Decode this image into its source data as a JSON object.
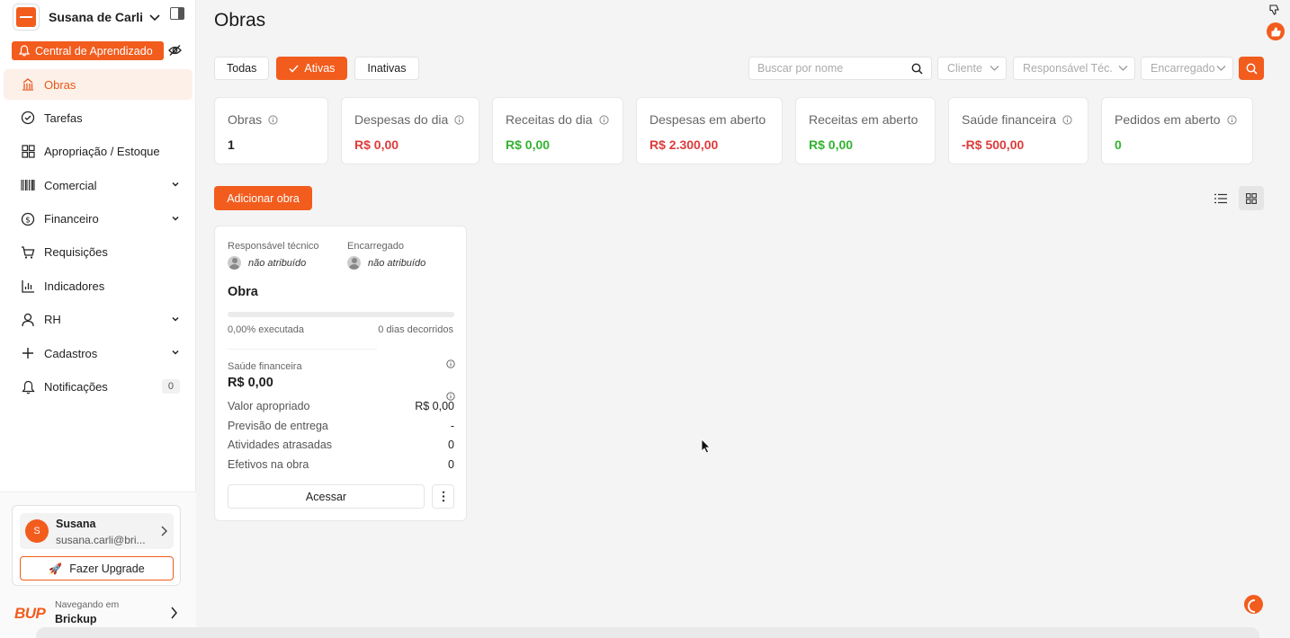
{
  "org": {
    "name": "Susana de Carli"
  },
  "learning": {
    "label": "Central de Aprendizado"
  },
  "nav": {
    "items": [
      {
        "label": "Obras"
      },
      {
        "label": "Tarefas"
      },
      {
        "label": "Apropriação / Estoque"
      },
      {
        "label": "Comercial"
      },
      {
        "label": "Financeiro"
      },
      {
        "label": "Requisições"
      },
      {
        "label": "Indicadores"
      },
      {
        "label": "RH"
      },
      {
        "label": "Cadastros"
      },
      {
        "label": "Notificações",
        "count": "0"
      }
    ]
  },
  "user": {
    "initial": "S",
    "name": "Susana",
    "email": "susana.carli@bri..."
  },
  "upgrade": {
    "label": "Fazer Upgrade"
  },
  "workspace": {
    "logo": "BUP",
    "label": "Navegando em",
    "name": "Brickup"
  },
  "page": {
    "title": "Obras"
  },
  "tabs": {
    "all": "Todas",
    "active": "Ativas",
    "inactive": "Inativas"
  },
  "filters": {
    "search_placeholder": "Buscar por nome",
    "client": "Cliente",
    "tech": "Responsável Téc.",
    "foreman": "Encarregado"
  },
  "stats": [
    {
      "label": "Obras",
      "value": "1"
    },
    {
      "label": "Despesas do dia",
      "value": "R$ 0,00"
    },
    {
      "label": "Receitas do dia",
      "value": "R$ 0,00"
    },
    {
      "label": "Despesas em aberto",
      "value": "R$ 2.300,00"
    },
    {
      "label": "Receitas em aberto",
      "value": "R$ 0,00"
    },
    {
      "label": "Saúde financeira",
      "value": "-R$ 500,00"
    },
    {
      "label": "Pedidos em aberto",
      "value": "0"
    }
  ],
  "actions": {
    "add": "Adicionar obra"
  },
  "card": {
    "tech_label": "Responsável técnico",
    "tech_value": "não atribuído",
    "foreman_label": "Encarregado",
    "foreman_value": "não atribuído",
    "title": "Obra",
    "progress": 0,
    "executed": "0,00% executada",
    "elapsed": "0 dias decorridos",
    "health_label": "Saúde financeira",
    "health_value": "R$ 0,00",
    "rows": [
      {
        "label": "Valor apropriado",
        "value": "R$ 0,00"
      },
      {
        "label": "Previsão de entrega",
        "value": "-"
      },
      {
        "label": "Atividades atrasadas",
        "value": "0"
      },
      {
        "label": "Efetivos na obra",
        "value": "0"
      }
    ],
    "access": "Acessar"
  },
  "colors": {
    "accent": "#f25c1d",
    "negative": "#de3b3b",
    "positive": "#34b233"
  }
}
